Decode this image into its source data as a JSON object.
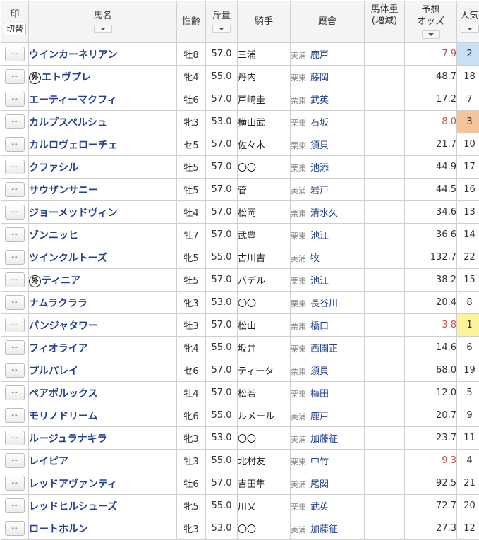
{
  "header": {
    "mark_label": "印",
    "mark_switch_label": "切替",
    "name_label": "馬名",
    "sexage_label": "性齢",
    "weight_label": "斤量",
    "jockey_label": "騎手",
    "stable_label": "厩舎",
    "bodyweight_label": "馬体重",
    "bodyweight_sub": "(増減)",
    "odds_label": "予想",
    "odds_sub": "オッズ",
    "popularity_label": "人気"
  },
  "horses": [
    {
      "mark": "--",
      "foreign": "",
      "name": "ウインカーネリアン",
      "sexage": "牡8",
      "weight": "57.0",
      "jockey": "三浦",
      "region": "美浦",
      "trainer": "鹿戸",
      "odds": "7.9",
      "pop": "2"
    },
    {
      "mark": "--",
      "foreign": "外",
      "name": "エトヴプレ",
      "sexage": "牝4",
      "weight": "55.0",
      "jockey": "丹内",
      "region": "栗東",
      "trainer": "藤岡",
      "odds": "48.7",
      "pop": "18"
    },
    {
      "mark": "--",
      "foreign": "",
      "name": "エーティーマクフィ",
      "sexage": "牡6",
      "weight": "57.0",
      "jockey": "戸崎圭",
      "region": "栗東",
      "trainer": "武英",
      "odds": "17.2",
      "pop": "7"
    },
    {
      "mark": "--",
      "foreign": "",
      "name": "カルプスペルシュ",
      "sexage": "牝3",
      "weight": "53.0",
      "jockey": "横山武",
      "region": "栗東",
      "trainer": "石坂",
      "odds": "8.0",
      "pop": "3"
    },
    {
      "mark": "--",
      "foreign": "",
      "name": "カルロヴェローチェ",
      "sexage": "セ5",
      "weight": "57.0",
      "jockey": "佐々木",
      "region": "栗東",
      "trainer": "須貝",
      "odds": "21.7",
      "pop": "10"
    },
    {
      "mark": "--",
      "foreign": "",
      "name": "クファシル",
      "sexage": "牡5",
      "weight": "57.0",
      "jockey": "〇〇",
      "region": "栗東",
      "trainer": "池添",
      "odds": "44.9",
      "pop": "17"
    },
    {
      "mark": "--",
      "foreign": "",
      "name": "サウザンサニー",
      "sexage": "牡5",
      "weight": "57.0",
      "jockey": "菅",
      "region": "美浦",
      "trainer": "岩戸",
      "odds": "44.5",
      "pop": "16"
    },
    {
      "mark": "--",
      "foreign": "",
      "name": "ジョーメッドヴィン",
      "sexage": "牡4",
      "weight": "57.0",
      "jockey": "松岡",
      "region": "栗東",
      "trainer": "清水久",
      "odds": "34.6",
      "pop": "13"
    },
    {
      "mark": "--",
      "foreign": "",
      "name": "ゾンニッヒ",
      "sexage": "牡7",
      "weight": "57.0",
      "jockey": "武豊",
      "region": "栗東",
      "trainer": "池江",
      "odds": "36.6",
      "pop": "14"
    },
    {
      "mark": "--",
      "foreign": "",
      "name": "ツインクルトーズ",
      "sexage": "牝5",
      "weight": "55.0",
      "jockey": "古川吉",
      "region": "美浦",
      "trainer": "牧",
      "odds": "132.7",
      "pop": "22"
    },
    {
      "mark": "--",
      "foreign": "外",
      "name": "ティニア",
      "sexage": "牡5",
      "weight": "57.0",
      "jockey": "バデル",
      "region": "栗東",
      "trainer": "池江",
      "odds": "38.2",
      "pop": "15"
    },
    {
      "mark": "--",
      "foreign": "",
      "name": "ナムラクララ",
      "sexage": "牝3",
      "weight": "53.0",
      "jockey": "〇〇",
      "region": "栗東",
      "trainer": "長谷川",
      "odds": "20.4",
      "pop": "8"
    },
    {
      "mark": "--",
      "foreign": "",
      "name": "パンジャタワー",
      "sexage": "牡3",
      "weight": "57.0",
      "jockey": "松山",
      "region": "栗東",
      "trainer": "橋口",
      "odds": "3.8",
      "pop": "1"
    },
    {
      "mark": "--",
      "foreign": "",
      "name": "フィオライア",
      "sexage": "牝4",
      "weight": "55.0",
      "jockey": "坂井",
      "region": "栗東",
      "trainer": "西園正",
      "odds": "14.6",
      "pop": "6"
    },
    {
      "mark": "--",
      "foreign": "",
      "name": "プルパレイ",
      "sexage": "セ6",
      "weight": "57.0",
      "jockey": "ティータ",
      "region": "栗東",
      "trainer": "須貝",
      "odds": "68.0",
      "pop": "19"
    },
    {
      "mark": "--",
      "foreign": "",
      "name": "ペアポルックス",
      "sexage": "牡4",
      "weight": "57.0",
      "jockey": "松若",
      "region": "栗東",
      "trainer": "梅田",
      "odds": "12.0",
      "pop": "5"
    },
    {
      "mark": "--",
      "foreign": "",
      "name": "モリノドリーム",
      "sexage": "牝6",
      "weight": "55.0",
      "jockey": "ルメール",
      "region": "美浦",
      "trainer": "鹿戸",
      "odds": "20.7",
      "pop": "9"
    },
    {
      "mark": "--",
      "foreign": "",
      "name": "ルージュラナキラ",
      "sexage": "牝3",
      "weight": "53.0",
      "jockey": "〇〇",
      "region": "美浦",
      "trainer": "加藤征",
      "odds": "23.7",
      "pop": "11"
    },
    {
      "mark": "--",
      "foreign": "",
      "name": "レイピア",
      "sexage": "牡3",
      "weight": "55.0",
      "jockey": "北村友",
      "region": "栗東",
      "trainer": "中竹",
      "odds": "9.3",
      "pop": "4"
    },
    {
      "mark": "--",
      "foreign": "",
      "name": "レッドアヴァンティ",
      "sexage": "牡6",
      "weight": "57.0",
      "jockey": "吉田隼",
      "region": "美浦",
      "trainer": "尾関",
      "odds": "92.5",
      "pop": "21"
    },
    {
      "mark": "--",
      "foreign": "",
      "name": "レッドヒルシューズ",
      "sexage": "牝5",
      "weight": "55.0",
      "jockey": "川又",
      "region": "栗東",
      "trainer": "武英",
      "odds": "72.7",
      "pop": "20"
    },
    {
      "mark": "--",
      "foreign": "",
      "name": "ロートホルン",
      "sexage": "牝3",
      "weight": "53.0",
      "jockey": "〇〇",
      "region": "美浦",
      "trainer": "加藤征",
      "odds": "27.3",
      "pop": "12"
    }
  ],
  "colors": {
    "pop1_bg": "#fcf39a",
    "pop2_bg": "#c9dff8",
    "pop3_bg": "#f6c49a",
    "hot_odds": "#c0504d",
    "name_link": "#23418f"
  }
}
